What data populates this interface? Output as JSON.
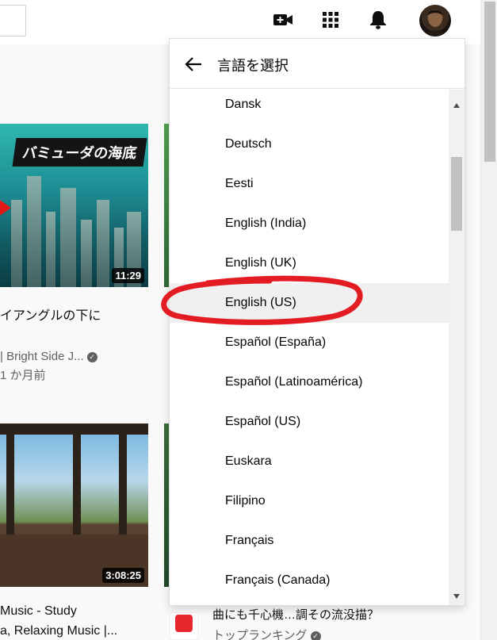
{
  "header": {
    "icons": [
      "video-camera-plus-icon",
      "apps-grid-icon",
      "notifications-bell-icon"
    ],
    "avatar": "user-avatar"
  },
  "videos": [
    {
      "overlay_text": "バミューダの海底",
      "duration": "11:29",
      "title_fragment": "イアングルの下に",
      "channel": "| Bright Side J...",
      "age": "1 か月前"
    },
    {
      "duration": "3:08:25",
      "title_line1": "Music - Study",
      "title_line2": "a, Relaxing Music |..."
    }
  ],
  "side_video": {
    "title_fragment": "曲にも千心機…調その流没描？",
    "channel": "トップランキング"
  },
  "language_menu": {
    "title": "言語を選択",
    "back_icon": "arrow-back-icon",
    "selected": "English (US)",
    "items": [
      "Dansk",
      "Deutsch",
      "Eesti",
      "English (India)",
      "English (UK)",
      "English (US)",
      "Español (España)",
      "Español (Latinoamérica)",
      "Español (US)",
      "Euskara",
      "Filipino",
      "Français",
      "Français (Canada)"
    ]
  },
  "colors": {
    "annotation_circle": "#e31b23",
    "selected_row": "#f0f0f0",
    "accent_red": "#e01818"
  }
}
